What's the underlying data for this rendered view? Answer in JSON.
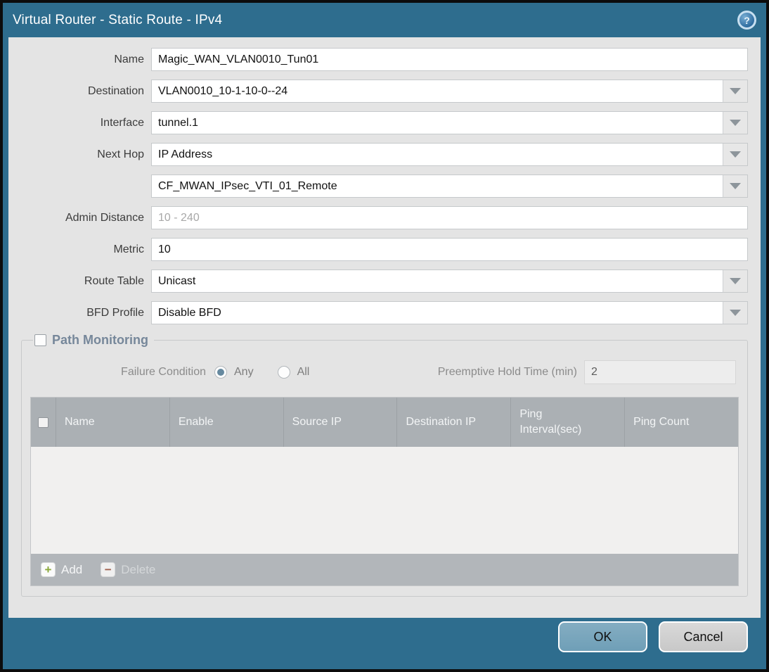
{
  "titlebar": {
    "title": "Virtual Router - Static Route - IPv4",
    "help_icon": "question-mark-circle",
    "help_glyph": "?"
  },
  "form": {
    "name": {
      "label": "Name",
      "value": "Magic_WAN_VLAN0010_Tun01"
    },
    "destination": {
      "label": "Destination",
      "value": "VLAN0010_10-1-10-0--24"
    },
    "interface": {
      "label": "Interface",
      "value": "tunnel.1"
    },
    "next_hop": {
      "label": "Next Hop",
      "value": "IP Address"
    },
    "next_hop_address": {
      "value": "CF_MWAN_IPsec_VTI_01_Remote"
    },
    "admin_distance": {
      "label": "Admin Distance",
      "value": "",
      "placeholder": "10 - 240"
    },
    "metric": {
      "label": "Metric",
      "value": "10"
    },
    "route_table": {
      "label": "Route Table",
      "value": "Unicast"
    },
    "bfd_profile": {
      "label": "BFD Profile",
      "value": "Disable BFD"
    }
  },
  "path_monitoring": {
    "title": "Path Monitoring",
    "enabled": false,
    "failure_condition": {
      "label": "Failure Condition",
      "options": [
        "Any",
        "All"
      ],
      "selected": "Any"
    },
    "preemptive_hold_time": {
      "label": "Preemptive Hold Time (min)",
      "value": "2"
    },
    "table": {
      "headers": [
        "Name",
        "Enable",
        "Source IP",
        "Destination IP",
        "Ping Interval(sec)",
        "Ping Count"
      ],
      "rows": [],
      "add_label": "Add",
      "delete_label": "Delete",
      "add_glyph": "+",
      "delete_glyph": "−"
    }
  },
  "footer": {
    "ok_label": "OK",
    "cancel_label": "Cancel"
  },
  "colors": {
    "frame_teal": "#2e6d8e",
    "content_gray": "#e4e4e4",
    "table_header_gray": "#abb0b4",
    "ok_button_blue": "#7aa6bc",
    "add_icon_green": "#8aa83a",
    "delete_icon_red": "#a0604c",
    "radio_selected_teal": "#66899f"
  }
}
